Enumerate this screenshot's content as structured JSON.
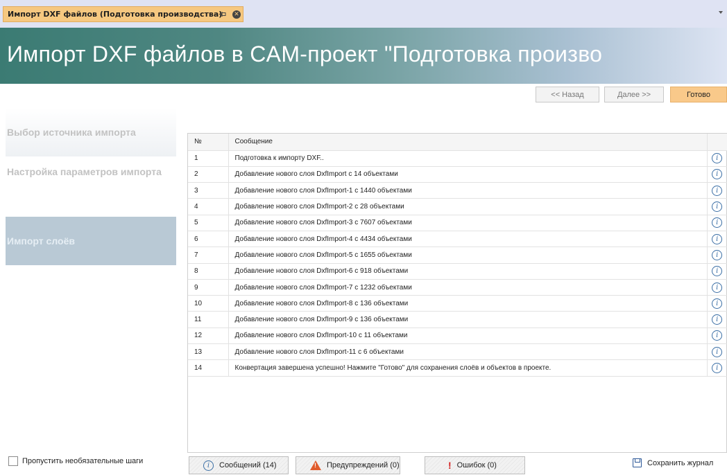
{
  "tab": {
    "title": "Импорт DXF файлов (Подготовка производства)",
    "pin_glyph": "⊸",
    "close_glyph": "✕"
  },
  "banner": {
    "title": "Импорт DXF файлов в CAM-проект \"Подготовка произво"
  },
  "nav": {
    "back_label": "<< Назад",
    "next_label": "Далее >>",
    "done_label": "Готово"
  },
  "steps": [
    {
      "label": "Выбор источника импорта"
    },
    {
      "label": "Настройка параметров импорта"
    },
    {
      "label": "Импорт слоёв"
    }
  ],
  "grid": {
    "columns": [
      "№",
      "Сообщение"
    ],
    "rows": [
      {
        "num": "1",
        "message": "Подготовка к импорту DXF.."
      },
      {
        "num": "2",
        "message": "Добавление нового слоя DxfImport с 14 объектами"
      },
      {
        "num": "3",
        "message": "Добавление нового слоя DxfImport-1 с 1440 объектами"
      },
      {
        "num": "4",
        "message": "Добавление нового слоя DxfImport-2 с 28 объектами"
      },
      {
        "num": "5",
        "message": "Добавление нового слоя DxfImport-3 с 7607 объектами"
      },
      {
        "num": "6",
        "message": "Добавление нового слоя DxfImport-4 с 4434 объектами"
      },
      {
        "num": "7",
        "message": "Добавление нового слоя DxfImport-5 с 1655 объектами"
      },
      {
        "num": "8",
        "message": "Добавление нового слоя DxfImport-6 с 918 объектами"
      },
      {
        "num": "9",
        "message": "Добавление нового слоя DxfImport-7 с 1232 объектами"
      },
      {
        "num": "10",
        "message": "Добавление нового слоя DxfImport-8 с 136 объектами"
      },
      {
        "num": "11",
        "message": "Добавление нового слоя DxfImport-9 с 136 объектами"
      },
      {
        "num": "12",
        "message": "Добавление нового слоя DxfImport-10 с 11 объектами"
      },
      {
        "num": "13",
        "message": "Добавление нового слоя DxfImport-11 с 6 объектами"
      },
      {
        "num": "14",
        "message": "Конвертация завершена успешно! Нажмите \"Готово\" для сохранения слоёв и объектов в проекте."
      }
    ],
    "row_icon": "info-icon"
  },
  "footer": {
    "skip_label": "Пропустить необязательные шаги",
    "messages_label": "Сообщений (14)",
    "warnings_label": "Предупреждений (0)",
    "errors_label": "Ошибок (0)",
    "save_label": "Сохранить журнал"
  },
  "colors": {
    "tab_active": "#f6c880",
    "done_button": "#f9c98a",
    "banner_start": "#3b7b73",
    "active_step": "#b9c9d5",
    "info_icon": "#3a6ea5"
  }
}
